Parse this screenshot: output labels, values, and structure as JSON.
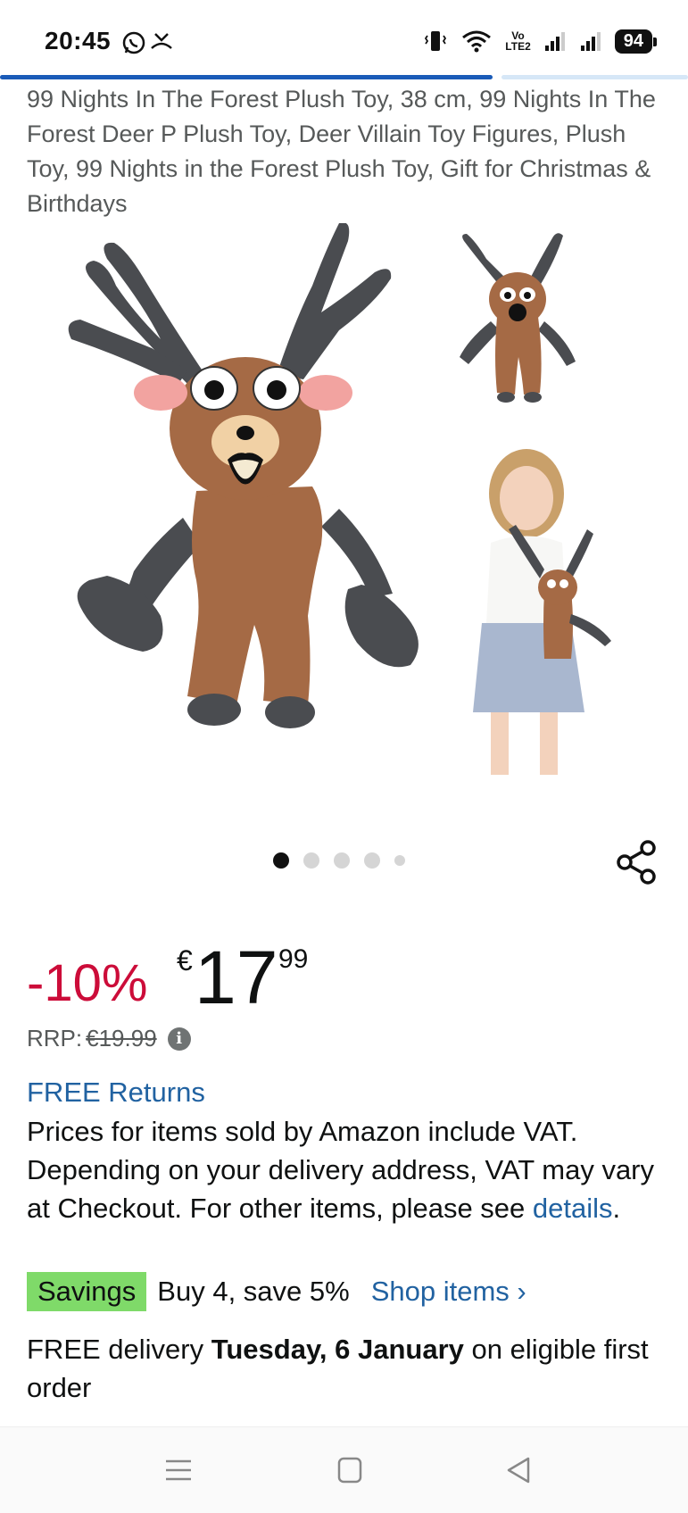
{
  "status_bar": {
    "time": "20:45",
    "battery": "94",
    "network_label_top": "Vo",
    "network_label_bottom": "LTE2",
    "icons": [
      "whatsapp-icon",
      "missed-call-icon",
      "vibrate-icon",
      "wifi-icon",
      "signal-icon",
      "signal-icon",
      "battery-icon"
    ]
  },
  "page_load_progress": 0.72,
  "product": {
    "title": "99 Nights In The Forest Plush Toy, 38 cm, 99 Nights In The Forest Deer P Plush Toy, Deer Villain Toy Figures, Plush Toy, 99 Nights in the Forest Plush Toy, Gift for Christmas & Birthdays",
    "image_count": 5,
    "active_image_index": 0
  },
  "price": {
    "discount": "-10%",
    "currency": "€",
    "whole": "17",
    "fraction": "99",
    "rrp_label": "RRP:",
    "rrp_value": "€19.99",
    "info_icon": "i"
  },
  "returns": {
    "label": "FREE Returns"
  },
  "vat_notice": {
    "text": "Prices for items sold by Amazon include VAT. Depending on your delivery address, VAT may vary at Checkout. For other items, please see ",
    "link": "details",
    "end": "."
  },
  "savings": {
    "badge": "Savings",
    "text": "Buy 4, save 5%",
    "link": "Shop items",
    "link_chevron": "›"
  },
  "delivery": {
    "prefix": "FREE delivery ",
    "date": "Tuesday, 6 January",
    "suffix": " on eligible first order"
  },
  "colors": {
    "discount_red": "#cc0c39",
    "link_blue": "#2162a1",
    "savings_green": "#7fda69",
    "progress_blue": "#1a5bb8"
  },
  "nav_bar": {
    "icons": [
      "menu-icon",
      "home-icon",
      "back-icon"
    ]
  }
}
